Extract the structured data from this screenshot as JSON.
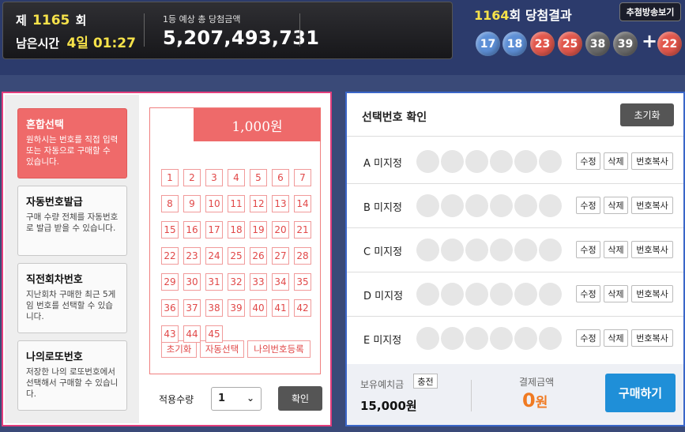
{
  "header": {
    "round_prefix": "제",
    "round_number": "1165",
    "round_suffix": "회",
    "remaining_label": "남은시간",
    "remaining_value": "4일 01:27",
    "prize_label": "1등 예상 총 당첨금액",
    "prize_amount": "5,207,493,731"
  },
  "last_result": {
    "round": "1164",
    "title_suffix": "회 당첨결과",
    "live_button": "추첨방송보기",
    "balls": [
      "17",
      "18",
      "23",
      "25",
      "38",
      "39"
    ],
    "plus": "+",
    "bonus": "22",
    "colors": {
      "blue": "#5d8fd6",
      "red": "#e2574c",
      "gray": "#6a6a6a"
    }
  },
  "menu": [
    {
      "title": "혼합선택",
      "desc": "원하시는 번호를 직접 입력 또는 자동으로 구매할 수 있습니다."
    },
    {
      "title": "자동번호발급",
      "desc": "구매 수량 전체를 자동번호로 발급 받을 수 있습니다."
    },
    {
      "title": "직전회차번호",
      "desc": "지난회차 구매한 최근 5게임 번호를 선택할 수 있습니다."
    },
    {
      "title": "나의로또번호",
      "desc": "저장한 나의 로또번호에서 선택해서 구매할 수 있습니다."
    }
  ],
  "ticket": {
    "price": "1,000원",
    "numbers": [
      "1",
      "2",
      "3",
      "4",
      "5",
      "6",
      "7",
      "8",
      "9",
      "10",
      "11",
      "12",
      "13",
      "14",
      "15",
      "16",
      "17",
      "18",
      "19",
      "20",
      "21",
      "22",
      "23",
      "24",
      "25",
      "26",
      "27",
      "28",
      "29",
      "30",
      "31",
      "32",
      "33",
      "34",
      "35",
      "36",
      "37",
      "38",
      "39",
      "40",
      "41",
      "42",
      "43",
      "44",
      "45"
    ],
    "reset_link": "초기화",
    "auto_link": "자동선택",
    "save_link": "나의번호등록"
  },
  "quantity": {
    "label": "적용수량",
    "value": "1",
    "confirm": "확인"
  },
  "selection": {
    "title": "선택번호 확인",
    "reset": "초기화",
    "rows": [
      {
        "label": "A 미지정"
      },
      {
        "label": "B 미지정"
      },
      {
        "label": "C 미지정"
      },
      {
        "label": "D 미지정"
      },
      {
        "label": "E 미지정"
      }
    ],
    "edit": "수정",
    "delete": "삭제",
    "copy": "번호복사"
  },
  "payment": {
    "deposit_label": "보유예치금",
    "charge": "충전",
    "deposit_amount": "15,000원",
    "pay_label": "결제금액",
    "pay_amount": "0",
    "pay_unit": "원",
    "buy": "구매하기"
  }
}
